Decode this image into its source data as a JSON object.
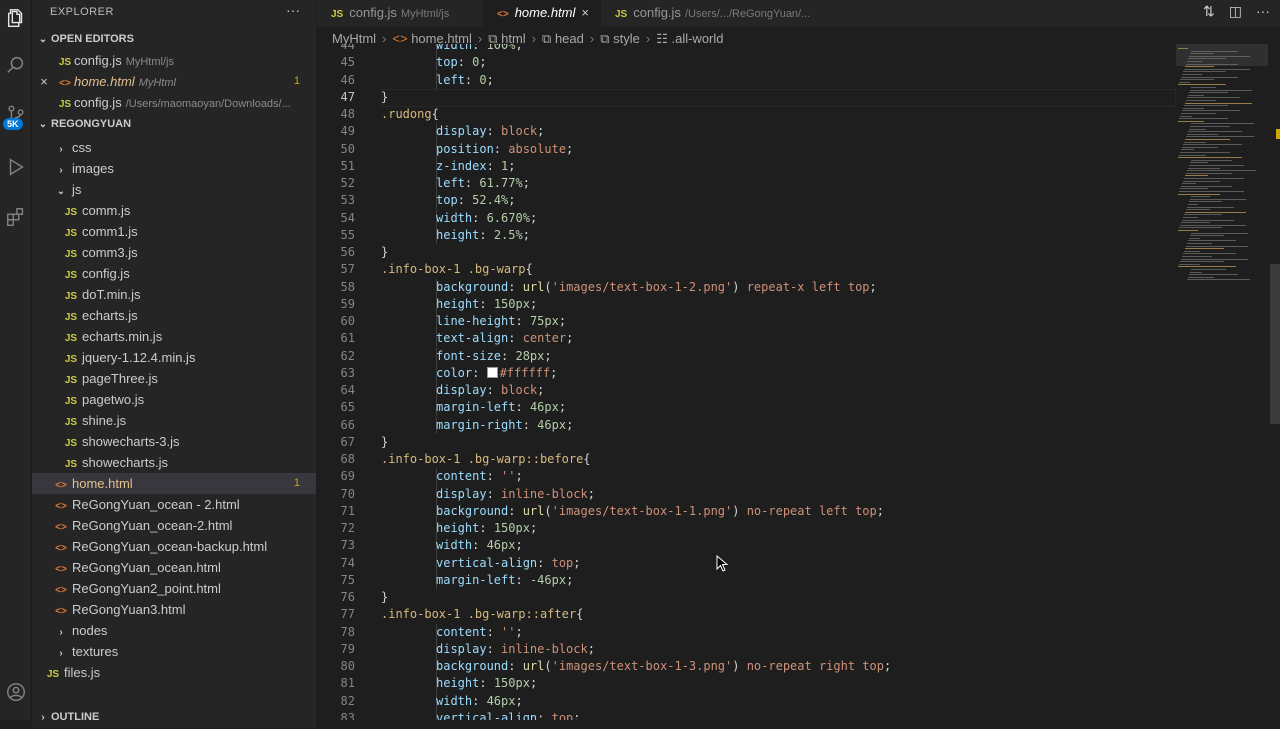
{
  "sidebar": {
    "title": "EXPLORER",
    "more": "···",
    "open_editors_label": "OPEN EDITORS",
    "open_editors": [
      {
        "icon": "JS",
        "name": "config.js",
        "desc": "MyHtml/js"
      },
      {
        "icon": "<>",
        "name": "home.html",
        "desc": "MyHtml",
        "count": "1"
      },
      {
        "icon": "JS",
        "name": "config.js",
        "desc": "/Users/maomaoyan/Downloads/..."
      }
    ],
    "project_label": "REGONGYUAN",
    "tree": [
      {
        "type": "folder",
        "name": "css"
      },
      {
        "type": "folder",
        "name": "images"
      },
      {
        "type": "folder-open",
        "name": "js"
      },
      {
        "type": "js",
        "name": "comm.js"
      },
      {
        "type": "js",
        "name": "comm1.js"
      },
      {
        "type": "js",
        "name": "comm3.js"
      },
      {
        "type": "js",
        "name": "config.js"
      },
      {
        "type": "js",
        "name": "doT.min.js"
      },
      {
        "type": "js",
        "name": "echarts.js"
      },
      {
        "type": "js",
        "name": "echarts.min.js"
      },
      {
        "type": "js",
        "name": "jquery-1.12.4.min.js"
      },
      {
        "type": "js",
        "name": "pageThree.js"
      },
      {
        "type": "js",
        "name": "pagetwo.js"
      },
      {
        "type": "js",
        "name": "shine.js"
      },
      {
        "type": "js",
        "name": "showecharts-3.js"
      },
      {
        "type": "js",
        "name": "showecharts.js"
      },
      {
        "type": "html",
        "name": "home.html",
        "count": "1"
      },
      {
        "type": "html",
        "name": "ReGongYuan_ocean - 2.html"
      },
      {
        "type": "html",
        "name": "ReGongYuan_ocean-2.html"
      },
      {
        "type": "html",
        "name": "ReGongYuan_ocean-backup.html"
      },
      {
        "type": "html",
        "name": "ReGongYuan_ocean.html"
      },
      {
        "type": "html",
        "name": "ReGongYuan2_point.html"
      },
      {
        "type": "html",
        "name": "ReGongYuan3.html"
      },
      {
        "type": "folder",
        "name": "nodes"
      },
      {
        "type": "folder",
        "name": "textures"
      },
      {
        "type": "js",
        "name": "files.js"
      }
    ],
    "outline_label": "OUTLINE"
  },
  "activity": {
    "badge": "5K"
  },
  "tabs": [
    {
      "icon": "JS",
      "name": "config.js",
      "desc": "MyHtml/js"
    },
    {
      "icon": "<>",
      "name": "home.html",
      "desc": "",
      "active": true
    },
    {
      "icon": "JS",
      "name": "config.js",
      "desc": "/Users/.../ReGongYuan/..."
    }
  ],
  "breadcrumb": [
    "MyHtml",
    "home.html",
    "html",
    "head",
    "style",
    ".all-world"
  ],
  "code": [
    {
      "n": "44",
      "t": [
        [
          "p",
          "width"
        ],
        [
          "u",
          ": "
        ],
        [
          "n",
          "100%"
        ],
        [
          "u",
          ";"
        ]
      ],
      "ind": 2
    },
    {
      "n": "45",
      "t": [
        [
          "p",
          "top"
        ],
        [
          "u",
          ": "
        ],
        [
          "n",
          "0"
        ],
        [
          "u",
          ";"
        ]
      ],
      "ind": 2
    },
    {
      "n": "46",
      "t": [
        [
          "p",
          "left"
        ],
        [
          "u",
          ": "
        ],
        [
          "n",
          "0"
        ],
        [
          "u",
          ";"
        ]
      ],
      "ind": 2
    },
    {
      "n": "47",
      "t": [
        [
          "u",
          "}"
        ]
      ],
      "ind": 1,
      "current": true
    },
    {
      "n": "48",
      "t": [
        [
          "s",
          ".rudong"
        ],
        [
          "u",
          "{"
        ]
      ],
      "ind": 1
    },
    {
      "n": "49",
      "t": [
        [
          "p",
          "display"
        ],
        [
          "u",
          ": "
        ],
        [
          "v",
          "block"
        ],
        [
          "u",
          ";"
        ]
      ],
      "ind": 2
    },
    {
      "n": "50",
      "t": [
        [
          "p",
          "position"
        ],
        [
          "u",
          ": "
        ],
        [
          "v",
          "absolute"
        ],
        [
          "u",
          ";"
        ]
      ],
      "ind": 2
    },
    {
      "n": "51",
      "t": [
        [
          "p",
          "z-index"
        ],
        [
          "u",
          ": "
        ],
        [
          "n",
          "1"
        ],
        [
          "u",
          ";"
        ]
      ],
      "ind": 2
    },
    {
      "n": "52",
      "t": [
        [
          "p",
          "left"
        ],
        [
          "u",
          ": "
        ],
        [
          "n",
          "61.77%"
        ],
        [
          "u",
          ";"
        ]
      ],
      "ind": 2
    },
    {
      "n": "53",
      "t": [
        [
          "p",
          "top"
        ],
        [
          "u",
          ": "
        ],
        [
          "n",
          "52.4%"
        ],
        [
          "u",
          ";"
        ]
      ],
      "ind": 2
    },
    {
      "n": "54",
      "t": [
        [
          "p",
          "width"
        ],
        [
          "u",
          ": "
        ],
        [
          "n",
          "6.670%"
        ],
        [
          "u",
          ";"
        ]
      ],
      "ind": 2
    },
    {
      "n": "55",
      "t": [
        [
          "p",
          "height"
        ],
        [
          "u",
          ": "
        ],
        [
          "n",
          "2.5%"
        ],
        [
          "u",
          ";"
        ]
      ],
      "ind": 2
    },
    {
      "n": "56",
      "t": [
        [
          "u",
          "}"
        ]
      ],
      "ind": 1
    },
    {
      "n": "57",
      "t": [
        [
          "s",
          ".info-box-1 .bg-warp"
        ],
        [
          "u",
          "{"
        ]
      ],
      "ind": 1
    },
    {
      "n": "58",
      "t": [
        [
          "p",
          "background"
        ],
        [
          "u",
          ": "
        ],
        [
          "f",
          "url"
        ],
        [
          "u",
          "("
        ],
        [
          "v",
          "'images/text-box-1-2.png'"
        ],
        [
          "u",
          ") "
        ],
        [
          "v",
          "repeat-x left top"
        ],
        [
          "u",
          ";"
        ]
      ],
      "ind": 2
    },
    {
      "n": "59",
      "t": [
        [
          "p",
          "height"
        ],
        [
          "u",
          ": "
        ],
        [
          "n",
          "150px"
        ],
        [
          "u",
          ";"
        ]
      ],
      "ind": 2
    },
    {
      "n": "60",
      "t": [
        [
          "p",
          "line-height"
        ],
        [
          "u",
          ": "
        ],
        [
          "n",
          "75px"
        ],
        [
          "u",
          ";"
        ]
      ],
      "ind": 2
    },
    {
      "n": "61",
      "t": [
        [
          "p",
          "text-align"
        ],
        [
          "u",
          ": "
        ],
        [
          "v",
          "center"
        ],
        [
          "u",
          ";"
        ]
      ],
      "ind": 2
    },
    {
      "n": "62",
      "t": [
        [
          "p",
          "font-size"
        ],
        [
          "u",
          ": "
        ],
        [
          "n",
          "28px"
        ],
        [
          "u",
          ";"
        ]
      ],
      "ind": 2
    },
    {
      "n": "63",
      "t": [
        [
          "p",
          "color"
        ],
        [
          "u",
          ": "
        ],
        [
          "c",
          ""
        ],
        [
          "v",
          "#ffffff"
        ],
        [
          "u",
          ";"
        ]
      ],
      "ind": 2
    },
    {
      "n": "64",
      "t": [
        [
          "p",
          "display"
        ],
        [
          "u",
          ": "
        ],
        [
          "v",
          "block"
        ],
        [
          "u",
          ";"
        ]
      ],
      "ind": 2
    },
    {
      "n": "65",
      "t": [
        [
          "p",
          "margin-left"
        ],
        [
          "u",
          ": "
        ],
        [
          "n",
          "46px"
        ],
        [
          "u",
          ";"
        ]
      ],
      "ind": 2
    },
    {
      "n": "66",
      "t": [
        [
          "p",
          "margin-right"
        ],
        [
          "u",
          ": "
        ],
        [
          "n",
          "46px"
        ],
        [
          "u",
          ";"
        ]
      ],
      "ind": 2
    },
    {
      "n": "67",
      "t": [
        [
          "u",
          "}"
        ]
      ],
      "ind": 1
    },
    {
      "n": "68",
      "t": [
        [
          "s",
          ".info-box-1 .bg-warp::before"
        ],
        [
          "u",
          "{"
        ]
      ],
      "ind": 1
    },
    {
      "n": "69",
      "t": [
        [
          "p",
          "content"
        ],
        [
          "u",
          ": "
        ],
        [
          "v",
          "''"
        ],
        [
          "u",
          ";"
        ]
      ],
      "ind": 2
    },
    {
      "n": "70",
      "t": [
        [
          "p",
          "display"
        ],
        [
          "u",
          ": "
        ],
        [
          "v",
          "inline-block"
        ],
        [
          "u",
          ";"
        ]
      ],
      "ind": 2
    },
    {
      "n": "71",
      "t": [
        [
          "p",
          "background"
        ],
        [
          "u",
          ": "
        ],
        [
          "f",
          "url"
        ],
        [
          "u",
          "("
        ],
        [
          "v",
          "'images/text-box-1-1.png'"
        ],
        [
          "u",
          ") "
        ],
        [
          "v",
          "no-repeat left top"
        ],
        [
          "u",
          ";"
        ]
      ],
      "ind": 2
    },
    {
      "n": "72",
      "t": [
        [
          "p",
          "height"
        ],
        [
          "u",
          ": "
        ],
        [
          "n",
          "150px"
        ],
        [
          "u",
          ";"
        ]
      ],
      "ind": 2
    },
    {
      "n": "73",
      "t": [
        [
          "p",
          "width"
        ],
        [
          "u",
          ": "
        ],
        [
          "n",
          "46px"
        ],
        [
          "u",
          ";"
        ]
      ],
      "ind": 2
    },
    {
      "n": "74",
      "t": [
        [
          "p",
          "vertical-align"
        ],
        [
          "u",
          ": "
        ],
        [
          "v",
          "top"
        ],
        [
          "u",
          ";"
        ]
      ],
      "ind": 2
    },
    {
      "n": "75",
      "t": [
        [
          "p",
          "margin-left"
        ],
        [
          "u",
          ": "
        ],
        [
          "n",
          "-46px"
        ],
        [
          "u",
          ";"
        ]
      ],
      "ind": 2
    },
    {
      "n": "76",
      "t": [
        [
          "u",
          "}"
        ]
      ],
      "ind": 1
    },
    {
      "n": "77",
      "t": [
        [
          "s",
          ".info-box-1 .bg-warp::after"
        ],
        [
          "u",
          "{"
        ]
      ],
      "ind": 1
    },
    {
      "n": "78",
      "t": [
        [
          "p",
          "content"
        ],
        [
          "u",
          ": "
        ],
        [
          "v",
          "''"
        ],
        [
          "u",
          ";"
        ]
      ],
      "ind": 2
    },
    {
      "n": "79",
      "t": [
        [
          "p",
          "display"
        ],
        [
          "u",
          ": "
        ],
        [
          "v",
          "inline-block"
        ],
        [
          "u",
          ";"
        ]
      ],
      "ind": 2
    },
    {
      "n": "80",
      "t": [
        [
          "p",
          "background"
        ],
        [
          "u",
          ": "
        ],
        [
          "f",
          "url"
        ],
        [
          "u",
          "("
        ],
        [
          "v",
          "'images/text-box-1-3.png'"
        ],
        [
          "u",
          ") "
        ],
        [
          "v",
          "no-repeat right top"
        ],
        [
          "u",
          ";"
        ]
      ],
      "ind": 2
    },
    {
      "n": "81",
      "t": [
        [
          "p",
          "height"
        ],
        [
          "u",
          ": "
        ],
        [
          "n",
          "150px"
        ],
        [
          "u",
          ";"
        ]
      ],
      "ind": 2
    },
    {
      "n": "82",
      "t": [
        [
          "p",
          "width"
        ],
        [
          "u",
          ": "
        ],
        [
          "n",
          "46px"
        ],
        [
          "u",
          ";"
        ]
      ],
      "ind": 2
    },
    {
      "n": "83",
      "t": [
        [
          "p",
          "vertical-align"
        ],
        [
          "u",
          ": "
        ],
        [
          "v",
          "top"
        ],
        [
          "u",
          ";"
        ]
      ],
      "ind": 2
    }
  ]
}
